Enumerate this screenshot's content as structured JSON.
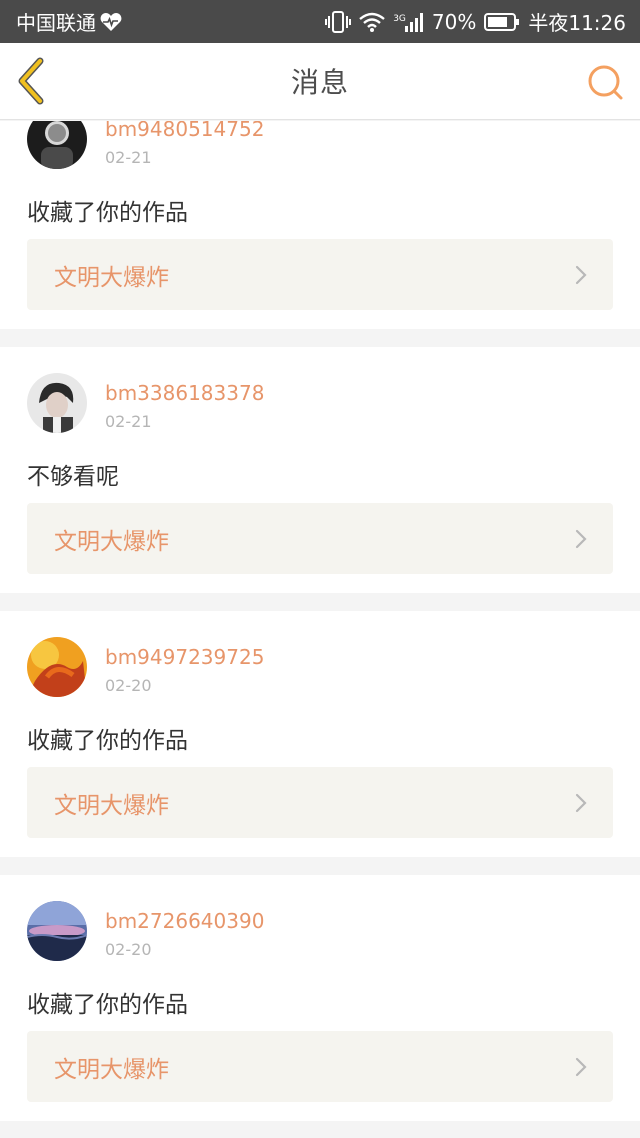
{
  "status_bar": {
    "carrier": "中国联通",
    "network_tag": "3G",
    "battery_percent": "70%",
    "time": "半夜11:26",
    "icons": [
      "heart-pulse-icon",
      "vibrate-icon",
      "wifi-icon",
      "signal-icon",
      "battery-icon"
    ]
  },
  "nav": {
    "title": "消息",
    "back_icon": "chevron-left-icon",
    "search_icon": "search-icon",
    "accent_color": "#f0c020",
    "search_color": "#f4a060"
  },
  "colors": {
    "username": "#e7956a",
    "date": "#b5b5b5",
    "message": "#333333",
    "work_bg": "#f5f4ef",
    "separator": "#f4f4f4"
  },
  "messages": [
    {
      "username": "bm9480514752",
      "date": "02-21",
      "text": "收藏了你的作品",
      "work_title": "文明大爆炸"
    },
    {
      "username": "bm3386183378",
      "date": "02-21",
      "text": "不够看呢",
      "work_title": "文明大爆炸"
    },
    {
      "username": "bm9497239725",
      "date": "02-20",
      "text": "收藏了你的作品",
      "work_title": "文明大爆炸"
    },
    {
      "username": "bm2726640390",
      "date": "02-20",
      "text": "收藏了你的作品",
      "work_title": "文明大爆炸"
    }
  ]
}
